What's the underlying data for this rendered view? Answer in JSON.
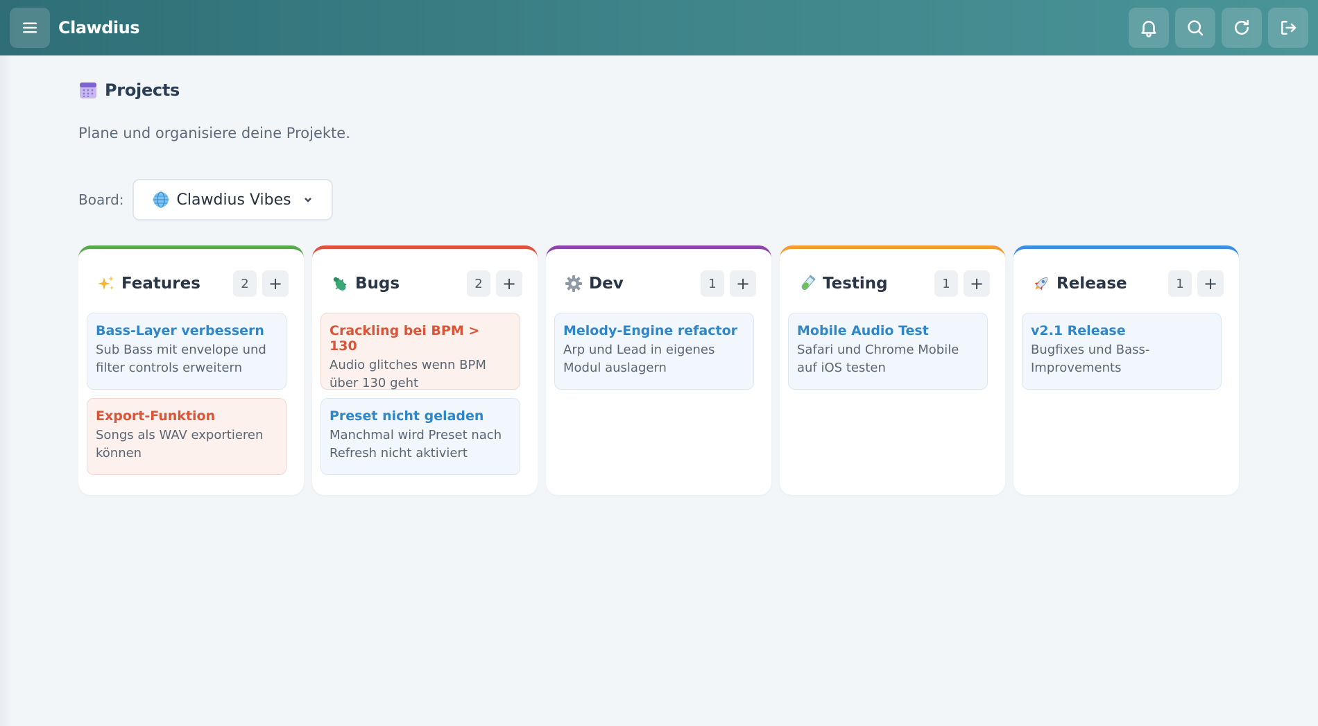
{
  "header": {
    "brand": "Clawdius"
  },
  "page": {
    "title": "Projects",
    "subtitle": "Plane und organisiere deine Projekte."
  },
  "board": {
    "label": "Board:",
    "selected": "Clawdius Vibes"
  },
  "columns": [
    {
      "title": "Features",
      "count": "2",
      "add": "+",
      "color": "#5aa84d",
      "icon": "sparkles-icon",
      "cards": [
        {
          "title": "Bass-Layer verbessern",
          "desc": "Sub Bass mit envelope und filter controls erweitern",
          "kind": "task"
        },
        {
          "title": "Export-Funktion",
          "desc": "Songs als WAV exportieren können",
          "kind": "bug"
        }
      ]
    },
    {
      "title": "Bugs",
      "count": "2",
      "add": "+",
      "color": "#e05140",
      "icon": "bug-icon",
      "cards": [
        {
          "title": "Crackling bei BPM > 130",
          "desc": "Audio glitches wenn BPM über 130 geht",
          "kind": "bug"
        },
        {
          "title": "Preset nicht geladen",
          "desc": "Manchmal wird Preset nach Refresh nicht aktiviert",
          "kind": "task"
        }
      ]
    },
    {
      "title": "Dev",
      "count": "1",
      "add": "+",
      "color": "#8e44ad",
      "icon": "gear-icon",
      "cards": [
        {
          "title": "Melody-Engine refactor",
          "desc": "Arp und Lead in eigenes Modul auslagern",
          "kind": "task"
        }
      ]
    },
    {
      "title": "Testing",
      "count": "1",
      "add": "+",
      "color": "#f39c2f",
      "icon": "test-tube-icon",
      "cards": [
        {
          "title": "Mobile Audio Test",
          "desc": "Safari und Chrome Mobile auf iOS testen",
          "kind": "task"
        }
      ]
    },
    {
      "title": "Release",
      "count": "1",
      "add": "+",
      "color": "#3b8fe0",
      "icon": "rocket-icon",
      "cards": [
        {
          "title": "v2.1 Release",
          "desc": "Bugfixes und Bass-Improvements",
          "kind": "task"
        }
      ]
    }
  ]
}
